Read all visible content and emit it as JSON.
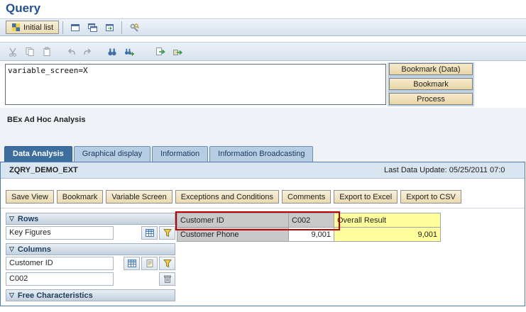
{
  "page": {
    "title": "Query"
  },
  "toolbar_top": {
    "initial_list_label": "Initial list",
    "icons": [
      "initial-list-icon",
      "new-session-icon",
      "copy-session-icon",
      "paste-session-icon",
      "customize-icon"
    ]
  },
  "toolbar_edit": {
    "icons": [
      "cut-icon",
      "copy-icon",
      "paste-icon",
      "undo-icon",
      "redo-icon",
      "find-icon",
      "find-next-icon",
      "execute-icon",
      "transport-icon"
    ]
  },
  "command_area": {
    "value": "variable_screen=X"
  },
  "side_buttons": [
    {
      "label": "Bookmark (Data)"
    },
    {
      "label": "Bookmark"
    },
    {
      "label": "Process"
    }
  ],
  "analysis": {
    "heading": "BEx Ad Hoc Analysis",
    "tabs": [
      {
        "label": "Data Analysis",
        "active": true
      },
      {
        "label": "Graphical display",
        "active": false
      },
      {
        "label": "Information",
        "active": false
      },
      {
        "label": "Information Broadcasting",
        "active": false
      }
    ],
    "query_name": "ZQRY_DEMO_EXT",
    "last_update": "Last Data Update: 05/25/2011 07:0",
    "action_buttons": [
      {
        "label": "Save View"
      },
      {
        "label": "Bookmark"
      },
      {
        "label": "Variable Screen"
      },
      {
        "label": "Exceptions and Conditions"
      },
      {
        "label": "Comments"
      },
      {
        "label": "Export to Excel"
      },
      {
        "label": "Export to CSV"
      }
    ],
    "nav_panel": {
      "sections": [
        {
          "title": "Rows"
        },
        {
          "title": "Columns"
        },
        {
          "title": "Free Characteristics"
        }
      ],
      "rows_item": "Key Figures",
      "columns_item": "Customer ID",
      "columns_value": "C002",
      "icons": [
        "table-icon",
        "filter-icon",
        "properties-icon",
        "trash-icon"
      ]
    },
    "result_table": {
      "header_row": {
        "label": "Customer ID",
        "value": "C002",
        "result_header": "Overall Result"
      },
      "data_row": {
        "label": "Customer Phone",
        "value": "9,001",
        "result": "9,001"
      }
    }
  },
  "colors": {
    "title_blue": "#24518F",
    "tab_active_blue": "#3E6E9E",
    "button_tan": "#F1E3BC",
    "highlight_red": "#C00000",
    "cell_yellow": "#FFFF9E",
    "cell_gray": "#C9C9C9",
    "side_panel_blue": "#BDD2E4"
  }
}
